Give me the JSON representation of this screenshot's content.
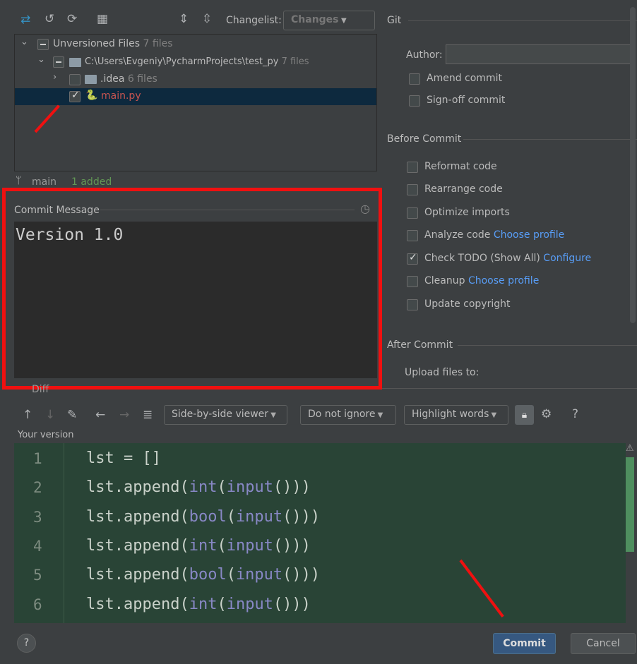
{
  "toolbar": {
    "changelist_label": "Changelist:",
    "changelist_value": "Changes"
  },
  "tree": {
    "root": {
      "label": "Unversioned Files",
      "count": "7 files"
    },
    "folder": {
      "label": "C:\\Users\\Evgeniy\\PycharmProjects\\test_py",
      "count": "7 files"
    },
    "idea": {
      "label": ".idea",
      "count": "6 files"
    },
    "file": {
      "label": "main.py",
      "checked": true
    }
  },
  "status": {
    "branch": "main",
    "added": "1 added"
  },
  "commit_message": {
    "label": "Commit Message",
    "value": "Version 1.0"
  },
  "git": {
    "title": "Git",
    "author_label": "Author:",
    "author_value": "",
    "amend": "Amend commit",
    "signoff": "Sign-off commit"
  },
  "before_commit": {
    "title": "Before Commit",
    "options": [
      {
        "label": "Reformat code",
        "checked": false
      },
      {
        "label": "Rearrange code",
        "checked": false
      },
      {
        "label": "Optimize imports",
        "checked": false
      },
      {
        "label": "Analyze code",
        "link": "Choose profile",
        "checked": false
      },
      {
        "label": "Check TODO (Show All)",
        "link": "Configure",
        "checked": true
      },
      {
        "label": "Cleanup",
        "link": "Choose profile",
        "checked": false
      },
      {
        "label": "Update copyright",
        "checked": false
      }
    ]
  },
  "after_commit": {
    "title": "After Commit",
    "upload_label": "Upload files to:"
  },
  "diff": {
    "title": "Diff",
    "viewer": "Side-by-side viewer",
    "ignore": "Do not ignore",
    "highlight": "Highlight words",
    "help": "?",
    "your_version": "Your version",
    "lines": [
      {
        "n": "1",
        "pre": "lst = []",
        "fn": "",
        "mid": "",
        "fn2": "",
        "post": ""
      },
      {
        "n": "2",
        "pre": "lst.append(",
        "fn": "int",
        "mid": "(",
        "fn2": "input",
        "post": "()))"
      },
      {
        "n": "3",
        "pre": "lst.append(",
        "fn": "bool",
        "mid": "(",
        "fn2": "input",
        "post": "()))"
      },
      {
        "n": "4",
        "pre": "lst.append(",
        "fn": "int",
        "mid": "(",
        "fn2": "input",
        "post": "()))"
      },
      {
        "n": "5",
        "pre": "lst.append(",
        "fn": "bool",
        "mid": "(",
        "fn2": "input",
        "post": "()))"
      },
      {
        "n": "6",
        "pre": "lst.append(",
        "fn": "int",
        "mid": "(",
        "fn2": "input",
        "post": "()))"
      }
    ]
  },
  "buttons": {
    "help": "?",
    "commit": "Commit",
    "cancel": "Cancel"
  },
  "colors": {
    "highlight_box": "#f01010",
    "diff_bg": "#294436",
    "accent_link": "#589df6",
    "added": "#629755",
    "file_modified": "#c75450"
  }
}
